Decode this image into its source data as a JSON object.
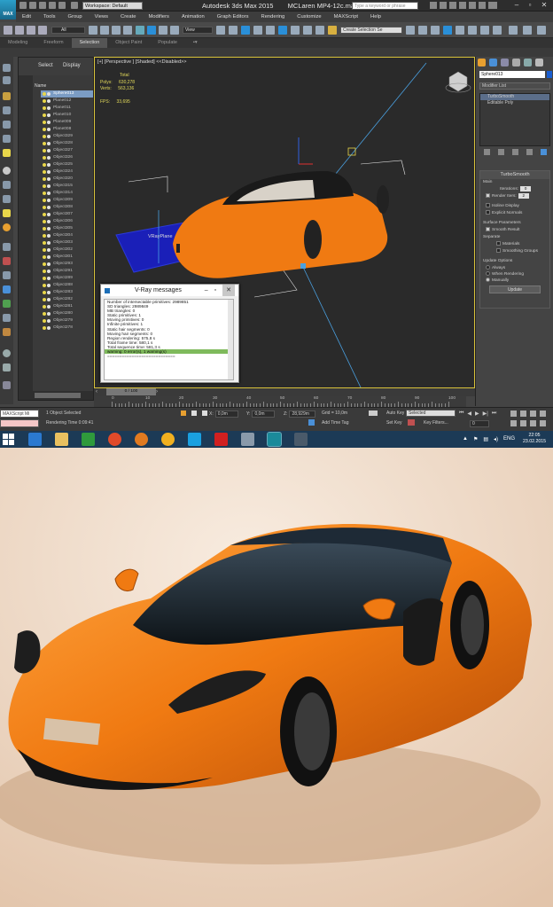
{
  "app": {
    "logo": "MAX",
    "workspace": "Workspace: Default",
    "title": "Autodesk 3ds Max 2015",
    "filename": "MCLaren MP4-12c.max",
    "search_placeholder": "Type a keyword or phrase"
  },
  "menu": [
    "Edit",
    "Tools",
    "Group",
    "Views",
    "Create",
    "Modifiers",
    "Animation",
    "Graph Editors",
    "Rendering",
    "Customize",
    "MAXScript",
    "Help"
  ],
  "toolbar": {
    "selection_filter": "All",
    "ref_coord": "View",
    "named_selection": "Create Selection Se"
  },
  "ribbon": {
    "tabs": [
      "Modeling",
      "Freeform",
      "Selection",
      "Object Paint",
      "Populate"
    ],
    "active": "Selection"
  },
  "scene_explorer": {
    "tab_select": "Select",
    "tab_display": "Display",
    "column_name": "Name",
    "items": [
      "Sphere013",
      "Plane012",
      "Plane011",
      "Plane010",
      "Plane009",
      "Plane008",
      "Object329",
      "Object328",
      "Object327",
      "Object326",
      "Object325",
      "Object324",
      "Object320",
      "Object315",
      "Object314",
      "Object309",
      "Object308",
      "Object307",
      "Object306",
      "Object305",
      "Object304",
      "Object303",
      "Object302",
      "Object301",
      "Object293",
      "Object291",
      "Object289",
      "Object288",
      "Object283",
      "Object282",
      "Object281",
      "Object280",
      "Object279",
      "Object278"
    ],
    "selected": "Sphere013"
  },
  "viewport": {
    "label": "[+] [Perspective ] [Shaded]  <<Disabled>>",
    "stats_header": "Total",
    "polys_label": "Polys:",
    "polys": "630,278",
    "verts_label": "Verts:",
    "verts": "563,136",
    "fps_label": "FPS:",
    "fps": "33,695",
    "vrayplane_label": "VRayPlane"
  },
  "vray_messages": {
    "title": "V-Ray messages",
    "lines": [
      "Number of intersectable primitives: 2989851",
      "  SD triangles: 2989849",
      "  MB triangles: 0",
      "  Static primitives: 1",
      "  Moving primitives: 0",
      "  Infinite primitives: 1",
      "  Static hair segments: 0",
      "  Moving hair segments: 0",
      "Region rendering: 575,8 s",
      "Total frame time: 580,1 s",
      "Total sequence time: 581,3 s",
      "warning: 0 error(s), 1 warning(s)",
      "============================"
    ],
    "warning_line_index": 11
  },
  "timeline": {
    "slider": "0 / 100",
    "ticks": [
      "0",
      "10",
      "20",
      "30",
      "40",
      "50",
      "60",
      "70",
      "80",
      "90",
      "100"
    ]
  },
  "command_panel": {
    "object_name": "Sphere013",
    "modifier_list": "Modifier List",
    "stack": [
      "TurboSmooth",
      "Editable Poly"
    ],
    "stack_selected": "TurboSmooth",
    "rollout_title": "TurboSmooth",
    "main_label": "Main",
    "iterations_label": "Iterations:",
    "iterations": "0",
    "render_iters_label": "Render Iters:",
    "render_iters": "2",
    "isoline_display": "Isoline Display",
    "explicit_normals": "Explicit Normals",
    "surface_parameters": "Surface Parameters",
    "smooth_result": "Smooth Result",
    "separate": "Separate",
    "materials": "Materials",
    "smoothing_groups": "Smoothing Groups",
    "update_options": "Update Options",
    "always": "Always",
    "when_rendering": "When Rendering",
    "manually": "Manually",
    "update_button": "Update"
  },
  "status": {
    "maxscript": "MAXScript Mi",
    "selected": "1 Object Selected",
    "rendering_time": "Rendering Time  0:09:41",
    "x_label": "X:",
    "x": "0,0m",
    "y_label": "Y:",
    "y": "0,0m",
    "z_label": "Z:",
    "z": "28,929m",
    "grid": "Grid = 10,0m",
    "add_time_tag": "Add Time Tag",
    "auto_key": "Auto Key",
    "auto_key_value": "Selected",
    "set_key": "Set Key",
    "key_filters": "Key Filters...",
    "frame": "0"
  },
  "taskbar": {
    "lang": "ENG",
    "time": "22:05",
    "date": "23.02.2015"
  },
  "colors": {
    "car_orange": "#f07a12",
    "ui_dark": "#444444",
    "viewport_border": "#d8c23a",
    "selection_blue": "#7b9cc4",
    "warning_green": "#7fba5c"
  }
}
